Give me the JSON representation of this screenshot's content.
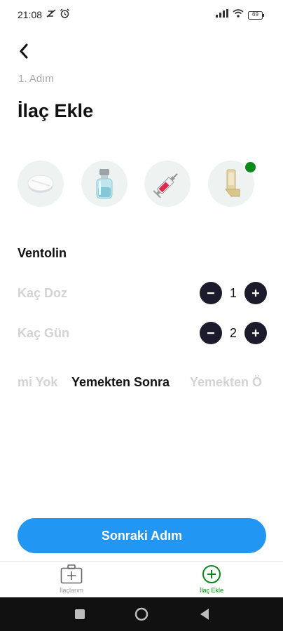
{
  "status_bar": {
    "time": "21:08",
    "battery": "69"
  },
  "header": {
    "step_label": "1. Adım",
    "title": "İlaç Ekle"
  },
  "medicine_types": [
    {
      "icon": "pill-icon",
      "selected": false
    },
    {
      "icon": "vial-icon",
      "selected": false
    },
    {
      "icon": "syringe-icon",
      "selected": false
    },
    {
      "icon": "inhaler-icon",
      "selected": true
    }
  ],
  "medicine": {
    "name": "Ventolin"
  },
  "dose": {
    "label": "Kaç Doz",
    "value": "1"
  },
  "days": {
    "label": "Kaç Gün",
    "value": "2"
  },
  "meal_options": {
    "items": [
      "mi Yok",
      "Yemekten Sonra",
      "Yemekten Ö"
    ],
    "selected": "Yemekten Sonra"
  },
  "actions": {
    "next_label": "Sonraki Adım"
  },
  "bottom_nav": {
    "items": [
      {
        "label": "İlaçlarım",
        "icon": "medical-kit-icon",
        "active": false
      },
      {
        "label": "İlaç Ekle",
        "icon": "add-circle-icon",
        "active": true
      }
    ]
  },
  "colors": {
    "accent": "#2196f3",
    "active_green": "#0b8a1c",
    "stepper_dark": "#1b1b2b",
    "muted_text": "#d3d3d3"
  }
}
